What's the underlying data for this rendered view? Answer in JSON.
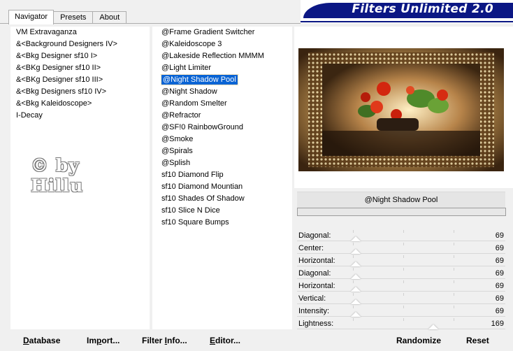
{
  "tabs": [
    "Navigator",
    "Presets",
    "About"
  ],
  "banner": {
    "title": "Filters Unlimited 2.0"
  },
  "watermark": {
    "line1": "© by",
    "line2": "Hillu"
  },
  "categories": [
    "VM Extravaganza",
    "&<Background Designers IV>",
    "&<Bkg Designer sf10 I>",
    "&<BKg Designer sf10 II>",
    "&<BKg Designer sf10 III>",
    "&<Bkg Designers sf10 IV>",
    "&<Bkg Kaleidoscope>",
    "I-Decay"
  ],
  "filters": [
    "@Frame Gradient Switcher",
    "@Kaleidoscope 3",
    "@Lakeside Reflection MMMM",
    "@Light Limiter",
    "@Night Shadow Pool",
    "@Night Shadow",
    "@Random Smelter",
    "@Refractor",
    "@SF!0 RainbowGround",
    "@Smoke",
    "@Spirals",
    "@Splish",
    "sf10 Diamond Flip",
    "sf10 Diamond Mountian",
    "sf10 Shades Of Shadow",
    "sf10 Slice N Dice",
    "sf10 Square Bumps"
  ],
  "selected_filter_index": 4,
  "selected_filter_name": "@Night Shadow Pool",
  "params": [
    {
      "label": "Diagonal:",
      "value": "69"
    },
    {
      "label": "Center:",
      "value": "69"
    },
    {
      "label": "Horizontal:",
      "value": "69"
    },
    {
      "label": "Diagonal:",
      "value": "69"
    },
    {
      "label": "Horizontal:",
      "value": "69"
    },
    {
      "label": "Vertical:",
      "value": "69"
    },
    {
      "label": "Intensity:",
      "value": "69"
    },
    {
      "label": "Lightness:",
      "value": "169"
    }
  ],
  "buttons": {
    "database": {
      "u": "D",
      "rest": "atabase"
    },
    "import": {
      "pre": "Im",
      "u": "p",
      "rest": "ort..."
    },
    "filter_info": {
      "pre": "Filter ",
      "u": "I",
      "rest": "nfo..."
    },
    "editor": {
      "u": "E",
      "rest": "ditor..."
    },
    "randomize": "Randomize",
    "reset": "Reset"
  },
  "colors": {
    "banner_blue": "#0b1784",
    "selection_blue": "#0a64d4"
  }
}
